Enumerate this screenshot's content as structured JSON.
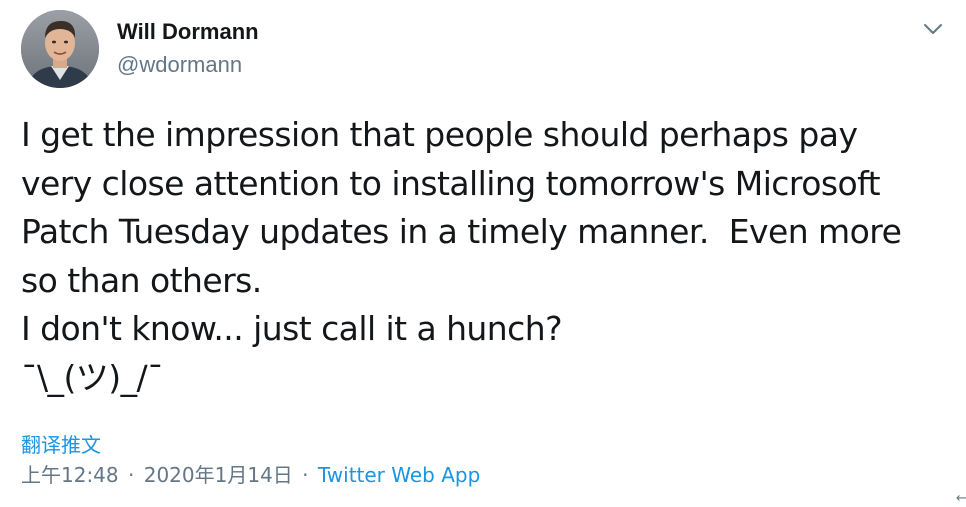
{
  "user": {
    "display_name": "Will Dormann",
    "handle": "@wdormann",
    "avatar_icon": "profile-photo-avatar"
  },
  "tweet": {
    "lines": [
      "I get the impression that people should perhaps pay",
      "very close attention to installing tomorrow's Microsoft",
      "Patch Tuesday updates in a timely manner.  Even more",
      "so than others.",
      "I don't know... just call it a hunch?",
      "¯\\_(ツ)_/¯"
    ]
  },
  "translate_label": "翻译推文",
  "meta": {
    "time": "上午12:48",
    "separator": "·",
    "date": "2020年1月14日",
    "source": "Twitter Web App"
  },
  "icons": {
    "caret": "chevron-down-icon",
    "corner": "left-arrow-icon"
  },
  "colors": {
    "text": "#14171a",
    "secondary": "#657786",
    "link": "#1b95e0"
  },
  "corner_glyph": "←"
}
